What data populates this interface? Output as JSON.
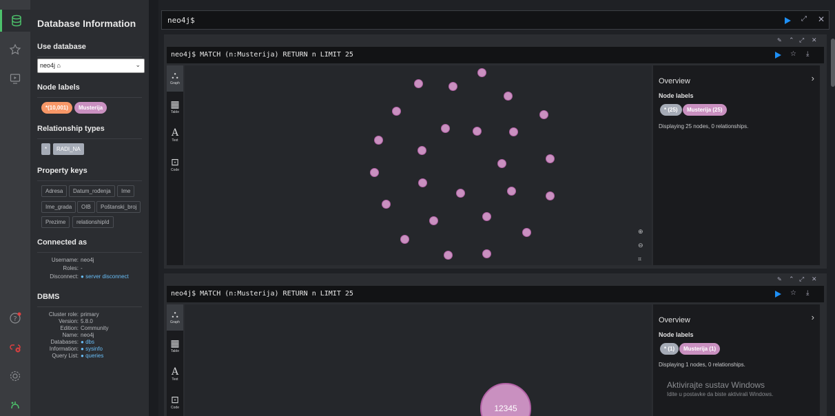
{
  "sidebar_icons": [
    "database-icon",
    "star-icon",
    "monitor-play-icon",
    "help-icon",
    "disconnect-icon",
    "settings-icon",
    "about-icon"
  ],
  "drawer": {
    "title": "Database Information",
    "use_database": "Use database",
    "selected_db": "neo4j",
    "node_labels_title": "Node labels",
    "node_labels": [
      {
        "text": "*(10,001)",
        "color": "#f79767"
      },
      {
        "text": "Musterija",
        "color": "#c990c0"
      }
    ],
    "rel_types_title": "Relationship types",
    "rel_types": [
      "*",
      "RADI_NA"
    ],
    "property_keys_title": "Property keys",
    "property_keys": [
      "Adresa",
      "Datum_rođenja",
      "Ime",
      "Ime_grada",
      "OIB",
      "Poštanski_broj",
      "Prezime",
      "relationshipId"
    ],
    "connected_as_title": "Connected as",
    "connected": {
      "username_k": "Username:",
      "username_v": "neo4j",
      "roles_k": "Roles:",
      "roles_v": "-",
      "disconnect_k": "Disconnect:",
      "disconnect_v": "server disconnect"
    },
    "dbms_title": "DBMS",
    "dbms": {
      "cluster_k": "Cluster role:",
      "cluster_v": "primary",
      "version_k": "Version:",
      "version_v": "5.8.0",
      "edition_k": "Edition:",
      "edition_v": "Community",
      "name_k": "Name:",
      "name_v": "neo4j",
      "databases_k": "Databases:",
      "databases_v": "dbs",
      "information_k": "Information:",
      "information_v": "sysinfo",
      "querylist_k": "Query List:",
      "querylist_v": "queries"
    }
  },
  "editor": {
    "prompt": "neo4j$"
  },
  "frames": [
    {
      "query": "neo4j$ MATCH (n:Musterija) RETURN n LIMIT 25",
      "tabs": [
        "Graph",
        "Table",
        "Text",
        "Code"
      ],
      "overview": {
        "title": "Overview",
        "node_labels_title": "Node labels",
        "badge_all": "* (25)",
        "badge_label": "Musterija (25)",
        "summary": "Displaying 25 nodes, 0 relationships."
      }
    },
    {
      "query": "neo4j$ MATCH (n:Musterija) RETURN n LIMIT 25",
      "tabs": [
        "Graph",
        "Table",
        "Text",
        "Code"
      ],
      "overview": {
        "title": "Overview",
        "node_labels_title": "Node labels",
        "badge_all": "* (1)",
        "badge_label": "Musterija (1)",
        "summary": "Displaying 1 nodes, 0 relationships."
      },
      "big_node_label": "12345"
    }
  ],
  "watermark": {
    "line1": "Aktivirajte sustav Windows",
    "line2": "Idite u postavke da biste aktivirali Windows."
  },
  "colors": {
    "accent": "#1e8ff4",
    "node": "#c990c0",
    "all_label": "#f79767",
    "success": "#4cc06b"
  }
}
